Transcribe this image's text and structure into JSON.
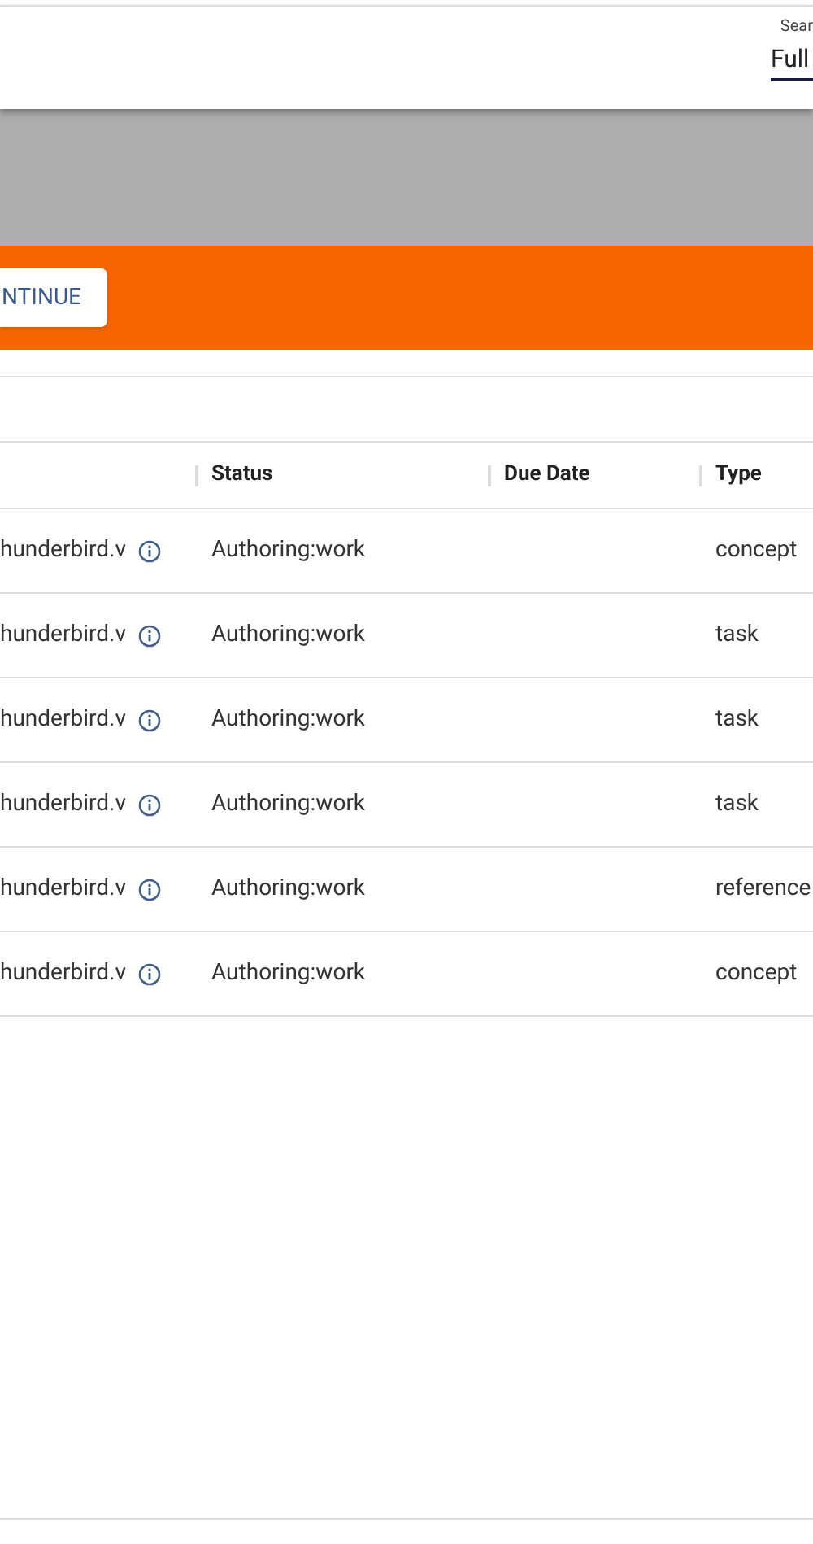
{
  "search": {
    "label": "Sear",
    "value": "Full"
  },
  "action_bar": {
    "button": "NTINUE"
  },
  "table": {
    "columns": [
      "Status",
      "Due Date",
      "Type"
    ],
    "rows": [
      {
        "name": "hunderbird.v",
        "status": "Authoring:work",
        "type": "concept"
      },
      {
        "name": "hunderbird.v",
        "status": "Authoring:work",
        "type": "task"
      },
      {
        "name": "hunderbird.v",
        "status": "Authoring:work",
        "type": "task"
      },
      {
        "name": "hunderbird.v",
        "status": "Authoring:work",
        "type": "task"
      },
      {
        "name": "hunderbird.v",
        "status": "Authoring:work",
        "type": "reference"
      },
      {
        "name": "hunderbird.v",
        "status": "Authoring:work",
        "type": "concept"
      }
    ]
  }
}
